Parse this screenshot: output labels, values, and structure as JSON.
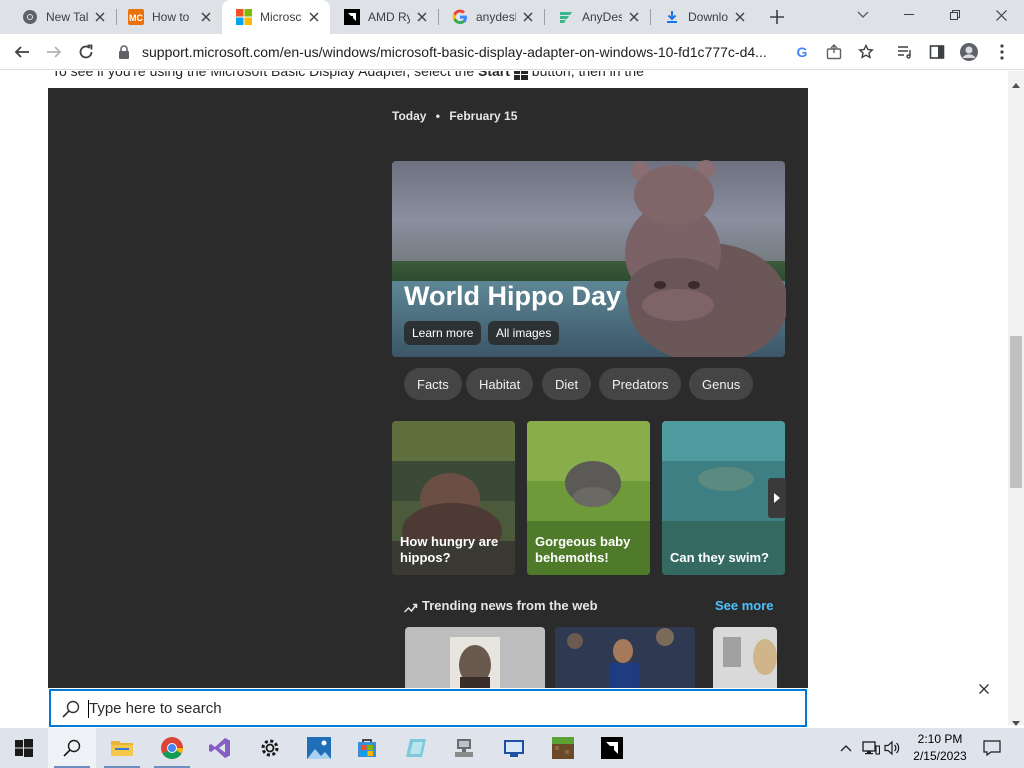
{
  "browser": {
    "tabs": [
      {
        "title": "New Tal",
        "favicon": "chrome-icon",
        "active": false
      },
      {
        "title": "How to",
        "favicon": "mc-icon",
        "active": false
      },
      {
        "title": "Microsc",
        "favicon": "microsoft-icon",
        "active": true
      },
      {
        "title": "AMD Ry",
        "favicon": "amd-icon",
        "active": false
      },
      {
        "title": "anydesk",
        "favicon": "google-icon",
        "active": false
      },
      {
        "title": "AnyDes",
        "favicon": "anydesk-icon",
        "active": false
      },
      {
        "title": "Downlo",
        "favicon": "download-icon",
        "active": false
      }
    ],
    "url": "support.microsoft.com/en-us/windows/microsoft-basic-display-adapter-on-windows-10-fd1c777c-d4..."
  },
  "page": {
    "partial_text_before": "To see if you're using the Microsoft Basic Display Adapter, select the ",
    "partial_text_bold": "Start",
    "partial_text_after": " button, then in the"
  },
  "flyout": {
    "date_label": "Today",
    "date_sep": "•",
    "date_value": "February 15",
    "hero_title": "World Hippo Day",
    "hero_buttons": [
      "Learn more",
      "All images"
    ],
    "chips": [
      "Facts",
      "Habitat",
      "Diet",
      "Predators",
      "Genus"
    ],
    "cards": [
      {
        "text": "How hungry are hippos?"
      },
      {
        "text": "Gorgeous baby behemoths!"
      },
      {
        "text": "Can they swim?"
      }
    ],
    "trending_label": "Trending news from the web",
    "see_more": "See more"
  },
  "search": {
    "placeholder": "Type here to search"
  },
  "taskbar": {
    "apps": [
      "start-icon",
      "search-icon",
      "file-explorer-icon",
      "chrome-icon",
      "visual-studio-icon",
      "settings-icon",
      "photos-icon",
      "store-icon",
      "app-icon",
      "network-icon",
      "remote-icon",
      "minecraft-icon",
      "amd-icon"
    ],
    "time": "2:10 PM",
    "date": "2/15/2023"
  }
}
